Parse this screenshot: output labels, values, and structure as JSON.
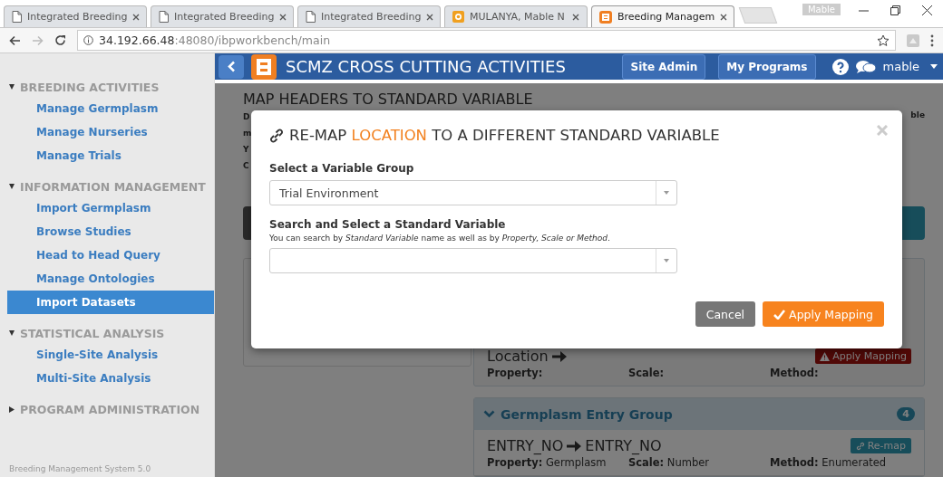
{
  "browser": {
    "tabs": [
      {
        "title": "Integrated Breeding",
        "kind": "page",
        "selected": false
      },
      {
        "title": "Integrated Breeding",
        "kind": "page",
        "selected": false
      },
      {
        "title": "Integrated Breeding",
        "kind": "page",
        "selected": false
      },
      {
        "title": "MULANYA, Mable N",
        "kind": "mail",
        "selected": false
      },
      {
        "title": "Breeding Managem",
        "kind": "app",
        "selected": true
      }
    ],
    "profile": "Mable",
    "url_host": "34.192.66.48",
    "url_path": ":48080/ibpworkbench/main"
  },
  "sidebar": {
    "sections": [
      {
        "title": "BREEDING ACTIVITIES",
        "expanded": true,
        "items": [
          {
            "label": "Manage Germplasm",
            "selected": false
          },
          {
            "label": "Manage Nurseries",
            "selected": false
          },
          {
            "label": "Manage Trials",
            "selected": false
          }
        ]
      },
      {
        "title": "INFORMATION MANAGEMENT",
        "expanded": true,
        "items": [
          {
            "label": "Import Germplasm",
            "selected": false
          },
          {
            "label": "Browse Studies",
            "selected": false
          },
          {
            "label": "Head to Head Query",
            "selected": false
          },
          {
            "label": "Manage Ontologies",
            "selected": false
          },
          {
            "label": "Import Datasets",
            "selected": true
          }
        ]
      },
      {
        "title": "STATISTICAL ANALYSIS",
        "expanded": true,
        "items": [
          {
            "label": "Single-Site Analysis",
            "selected": false
          },
          {
            "label": "Multi-Site Analysis",
            "selected": false
          }
        ]
      },
      {
        "title": "PROGRAM ADMINISTRATION",
        "expanded": false
      }
    ],
    "footer": "Breeding Management System 5.0"
  },
  "header": {
    "title": "SCMZ CROSS CUTTING ACTIVITIES",
    "buttons": [
      "Site Admin",
      "My Programs"
    ],
    "user": "mable"
  },
  "page": {
    "title": "MAP HEADERS TO STANDARD VARIABLE",
    "fragments_left": [
      "D",
      "m",
      "Y",
      "C"
    ],
    "fragment_right": "ble",
    "location_row": {
      "header": "Location",
      "warning_button": "Apply Mapping",
      "labels": [
        "Property:",
        "Scale:",
        "Method:"
      ]
    },
    "group": {
      "title": "Germplasm Entry Group",
      "count": "4",
      "expanded": true,
      "row": {
        "header": "ENTRY_NO",
        "target": "ENTRY_NO",
        "button": "Re-map",
        "fields": [
          {
            "label": "Property:",
            "value": "Germplasm"
          },
          {
            "label": "Scale:",
            "value": "Number"
          },
          {
            "label": "Method:",
            "value": "Enumerated"
          }
        ]
      }
    }
  },
  "modal": {
    "title_before": "RE-MAP",
    "highlight": "LOCATION",
    "title_after": "TO A DIFFERENT STANDARD VARIABLE",
    "group_label": "Select a Variable Group",
    "group_value": "Trial Environment",
    "search_label": "Search and Select a Standard Variable",
    "search_hint": "You can search by *Standard Variable* name as well as by *Property, Scale or Method*.",
    "buttons": [
      {
        "label": "Cancel",
        "kind": "secondary"
      },
      {
        "label": "Apply Mapping",
        "kind": "primary"
      }
    ]
  }
}
